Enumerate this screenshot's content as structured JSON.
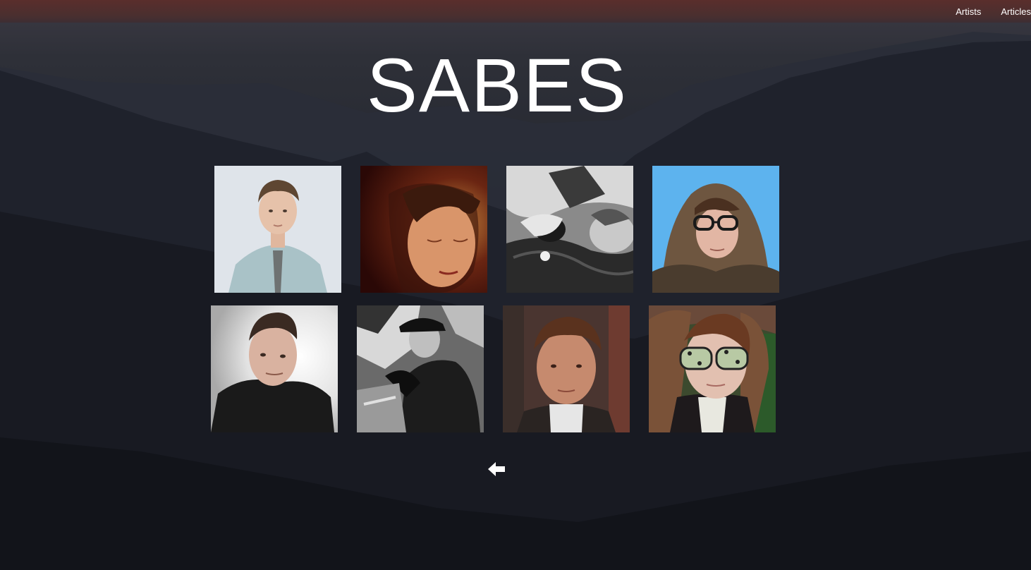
{
  "nav": {
    "items": [
      {
        "label": "Artists"
      },
      {
        "label": "Articles"
      }
    ]
  },
  "page": {
    "title": "SABES"
  },
  "artists": [
    {
      "icon": "artist-photo-1"
    },
    {
      "icon": "artist-photo-2"
    },
    {
      "icon": "artist-photo-3"
    },
    {
      "icon": "artist-photo-4"
    },
    {
      "icon": "artist-photo-5"
    },
    {
      "icon": "artist-photo-6"
    },
    {
      "icon": "artist-photo-7"
    },
    {
      "icon": "artist-photo-8"
    }
  ],
  "back": {
    "icon": "back-arrow-icon"
  },
  "colors": {
    "topbar": "#4a2f2f",
    "text": "#ffffff",
    "background": "#15171e"
  }
}
